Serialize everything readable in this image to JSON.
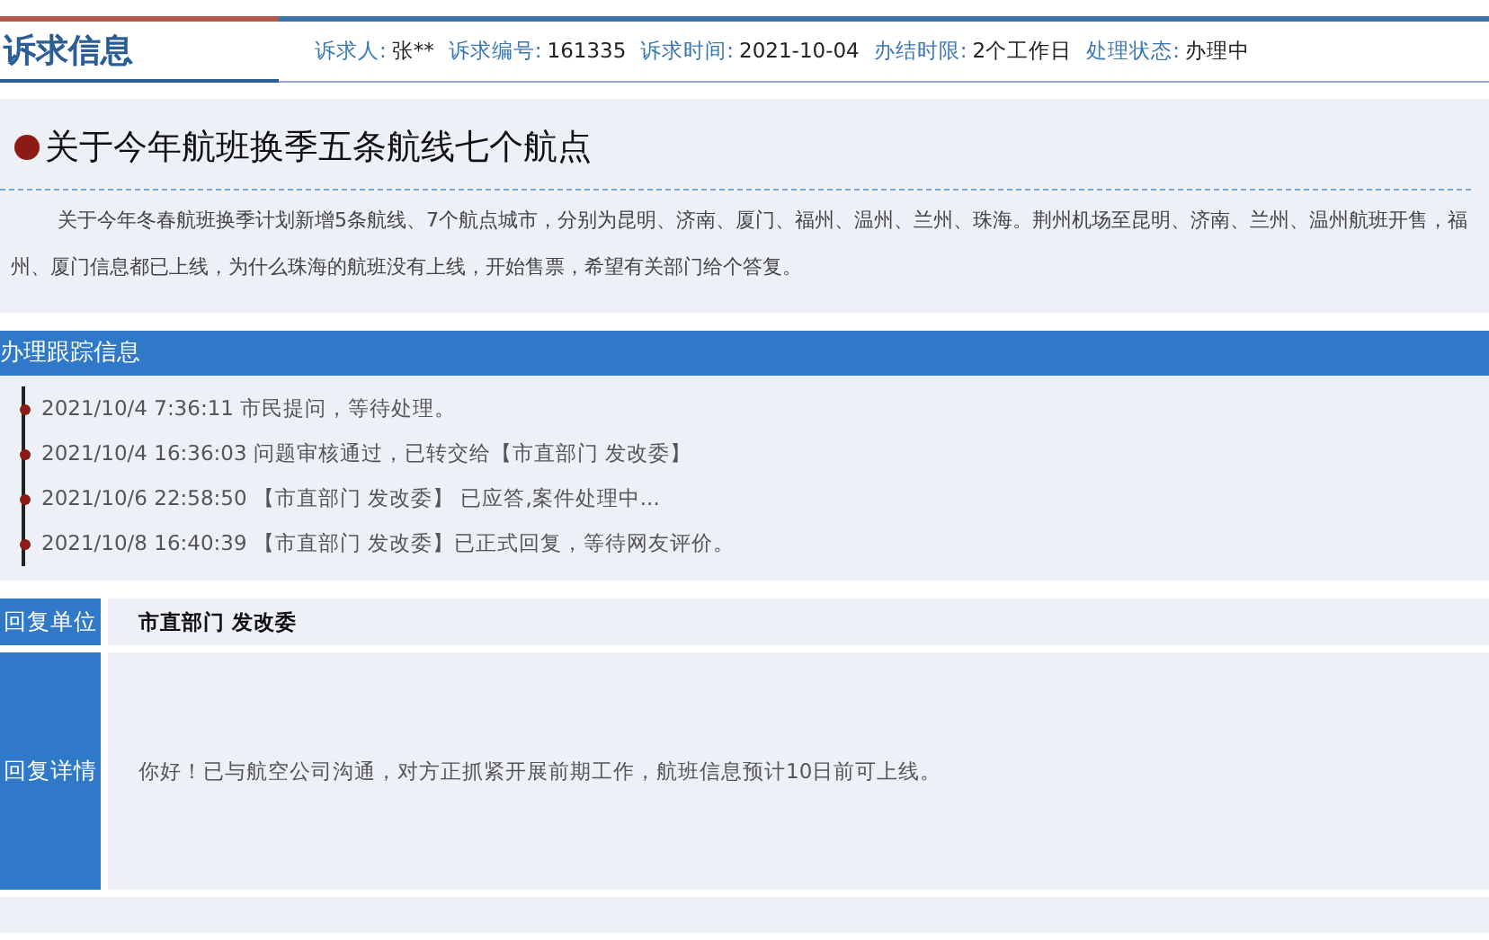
{
  "header": {
    "title": "诉求信息",
    "meta": [
      {
        "label": "诉求人:",
        "value": "张**"
      },
      {
        "label": "诉求编号:",
        "value": "161335"
      },
      {
        "label": "诉求时间:",
        "value": "2021-10-04"
      },
      {
        "label": "办结时限:",
        "value": "2个工作日"
      },
      {
        "label": "处理状态:",
        "value": "办理中"
      }
    ]
  },
  "question": {
    "title": "关于今年航班换季五条航线七个航点",
    "body": "关于今年冬春航班换季计划新增5条航线、7个航点城市，分别为昆明、济南、厦门、福州、温州、兰州、珠海。荆州机场至昆明、济南、兰州、温州航班开售，福州、厦门信息都已上线，为什么珠海的航班没有上线，开始售票，希望有关部门给个答复。"
  },
  "tracking": {
    "title": "办理跟踪信息",
    "items": [
      "2021/10/4 7:36:11 市民提问，等待处理。",
      "2021/10/4 16:36:03 问题审核通过，已转交给【市直部门 发改委】",
      "2021/10/6 22:58:50 【市直部门 发改委】 已应答,案件处理中...",
      "2021/10/8 16:40:39 【市直部门 发改委】已正式回复，等待网友评价。"
    ]
  },
  "reply": [
    {
      "kind": "unit",
      "label": "回复单位",
      "value": "市直部门 发改委"
    },
    {
      "kind": "detail",
      "label": "回复详情",
      "value": "你好！已与航空公司沟通，对方正抓紧开展前期工作，航班信息预计10日前可上线。"
    }
  ]
}
